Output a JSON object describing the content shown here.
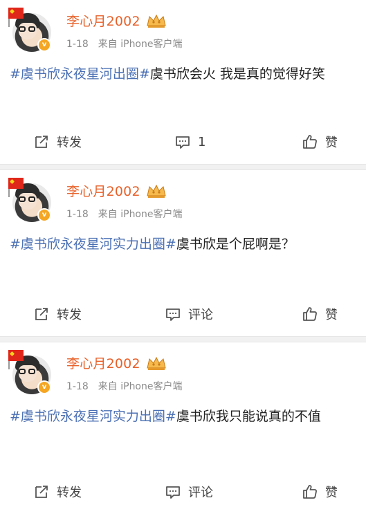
{
  "posts": [
    {
      "username": "李心月2002",
      "date": "1-18",
      "source": "来自 iPhone客户端",
      "tag": "#虞书欣永夜星河出圈#",
      "text": "虞书欣会火 我是真的觉得好笑",
      "share_label": "转发",
      "comment_label": "1",
      "like_label": "赞"
    },
    {
      "username": "李心月2002",
      "date": "1-18",
      "source": "来自 iPhone客户端",
      "tag": "#虞书欣永夜星河实力出圈#",
      "text": "虞书欣是个屁啊是？",
      "share_label": "转发",
      "comment_label": "评论",
      "like_label": "赞"
    },
    {
      "username": "李心月2002",
      "date": "1-18",
      "source": "来自 iPhone客户端",
      "tag": "#虞书欣永夜星河实力出圈#",
      "text": "虞书欣我只能说真的不值",
      "share_label": "转发",
      "comment_label": "评论",
      "like_label": "赞"
    }
  ],
  "icons": {
    "share": "share-icon",
    "comment": "comment-icon",
    "like": "thumbs-up-icon",
    "crown": "crown-badge-icon",
    "flag": "flag-icon"
  },
  "colors": {
    "username": "#e8612a",
    "topic": "#4a6fb3",
    "meta": "#8a8a8a",
    "divider": "#f1f1f1"
  }
}
